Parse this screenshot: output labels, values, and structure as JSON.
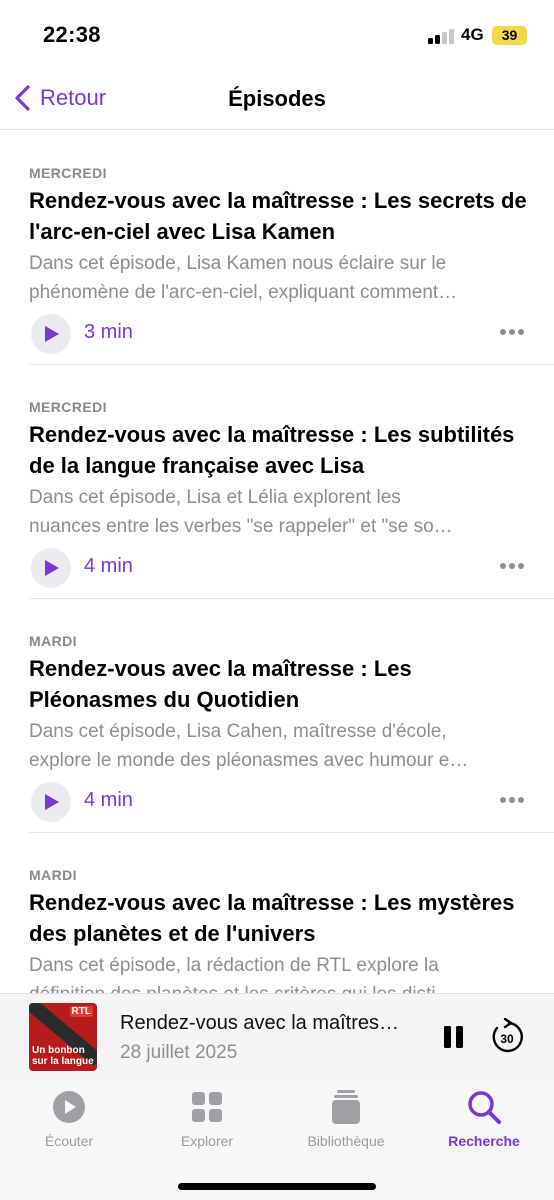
{
  "status_bar": {
    "time": "22:38",
    "network": "4G",
    "battery": "39"
  },
  "nav": {
    "back_label": "Retour",
    "title": "Épisodes"
  },
  "episodes": [
    {
      "day": "MERCREDI",
      "title": "Rendez-vous avec la maîtresse : Les secrets de l'arc-en-ciel avec Lisa Kamen",
      "desc_line1": "Dans cet épisode, Lisa Kamen nous éclaire sur le",
      "desc_line2": "phénomène de l'arc-en-ciel, expliquant comment…",
      "duration": "3 min"
    },
    {
      "day": "MERCREDI",
      "title": "Rendez-vous avec la maîtresse : Les subtilités de la langue française avec Lisa",
      "desc_line1": "Dans cet épisode, Lisa et Lélia explorent les",
      "desc_line2": "nuances entre les verbes \"se rappeler\" et \"se so…",
      "duration": "4 min"
    },
    {
      "day": "MARDI",
      "title": "Rendez-vous avec la maîtresse :  Les Pléonasmes du Quotidien",
      "desc_line1": "Dans cet épisode, Lisa Cahen, maîtresse d'école,",
      "desc_line2": "explore le monde des pléonasmes avec humour e…",
      "duration": "4 min"
    },
    {
      "day": "MARDI",
      "title": "Rendez-vous avec la maîtresse :  Les mystères des planètes et de l'univers",
      "desc_line1": "Dans cet épisode, la rédaction de RTL explore la",
      "desc_line2": "définition des planètes et les critères qui les disti…",
      "duration": ""
    }
  ],
  "mini_player": {
    "title": "Rendez-vous avec la maîtres…",
    "date": "28 juillet 2025",
    "artwork_logo": "RTL",
    "artwork_caption_1": "Un bonbon",
    "artwork_caption_2": "sur la langue",
    "skip_seconds": "30"
  },
  "tabs": [
    {
      "label": "Écouter",
      "icon": "play-circle-icon",
      "active": false
    },
    {
      "label": "Explorer",
      "icon": "grid-icon",
      "active": false
    },
    {
      "label": "Bibliothèque",
      "icon": "library-stack-icon",
      "active": false
    },
    {
      "label": "Recherche",
      "icon": "search-icon",
      "active": true
    }
  ],
  "colors": {
    "accent": "#7d36d6",
    "secondary_text": "#8e8e93",
    "battery": "#f2d94a"
  }
}
